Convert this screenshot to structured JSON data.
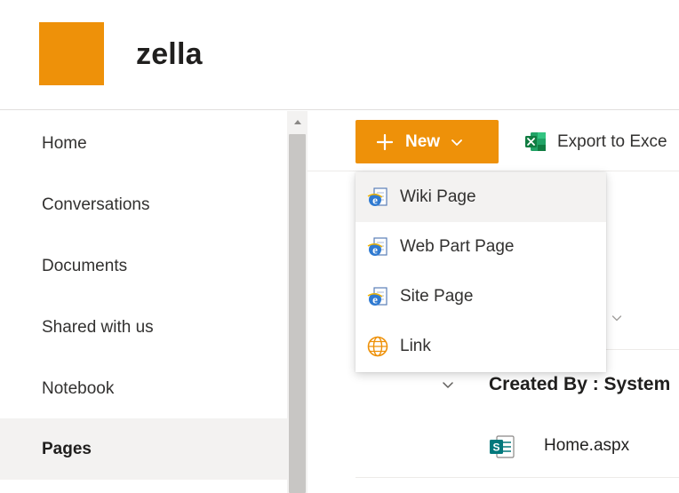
{
  "header": {
    "site_title": "zella",
    "logo_color": "#ee9109"
  },
  "leftnav": {
    "items": [
      {
        "label": "Home"
      },
      {
        "label": "Conversations"
      },
      {
        "label": "Documents"
      },
      {
        "label": "Shared with us"
      },
      {
        "label": "Notebook"
      },
      {
        "label": "Pages",
        "selected": true
      }
    ]
  },
  "commandbar": {
    "new_label": "New",
    "new_icon": "plus-icon",
    "export_label": "Export to Exce",
    "export_icon": "excel-icon",
    "accent_color": "#ee9109"
  },
  "new_menu": {
    "items": [
      {
        "label": "Wiki Page",
        "icon": "ie-page-icon"
      },
      {
        "label": "Web Part Page",
        "icon": "ie-page-icon"
      },
      {
        "label": "Site Page",
        "icon": "ie-page-icon"
      },
      {
        "label": "Link",
        "icon": "globe-icon"
      }
    ]
  },
  "list": {
    "group_header": "Created By : System",
    "files": [
      {
        "name": "Home.aspx",
        "icon": "sharepoint-page-icon"
      }
    ]
  }
}
